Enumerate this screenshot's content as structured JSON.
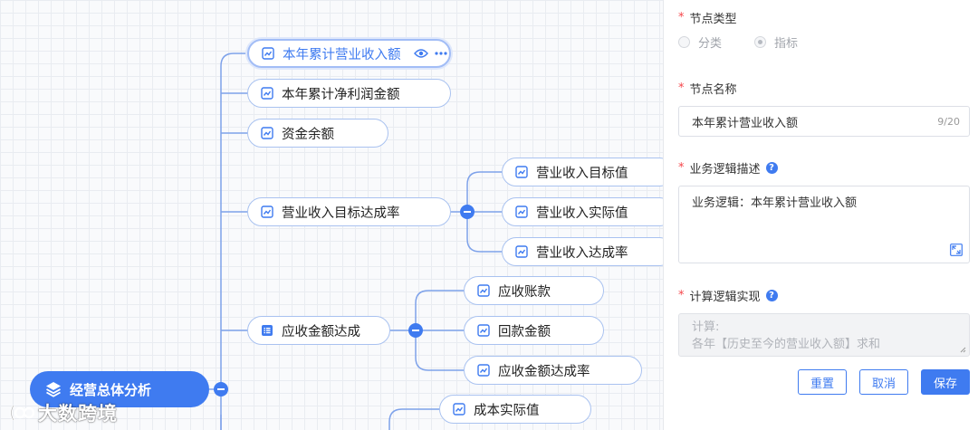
{
  "mindmap": {
    "root": {
      "label": "经营总体分析"
    },
    "nodes": [
      {
        "label": "本年累计营业收入额",
        "icon": "trend-chart-icon"
      },
      {
        "label": "本年累计净利润金额",
        "icon": "trend-chart-icon"
      },
      {
        "label": "资金余额",
        "icon": "trend-chart-icon"
      },
      {
        "label": "营业收入目标达成率",
        "icon": "trend-chart-icon"
      },
      {
        "label": "营业收入目标值",
        "icon": "trend-chart-icon"
      },
      {
        "label": "营业收入实际值",
        "icon": "trend-chart-icon"
      },
      {
        "label": "营业收入达成率",
        "icon": "trend-chart-icon"
      },
      {
        "label": "应收金额达成",
        "icon": "list-icon"
      },
      {
        "label": "应收账款",
        "icon": "trend-chart-icon"
      },
      {
        "label": "回款金额",
        "icon": "trend-chart-icon"
      },
      {
        "label": "应收金额达成率",
        "icon": "trend-chart-icon"
      },
      {
        "label": "成本实际值",
        "icon": "trend-chart-icon"
      }
    ],
    "watermark": "大数跨境",
    "colors": {
      "accent": "#3f7bf0",
      "node_border": "#a9c2f0",
      "line": "#7ea2ea"
    }
  },
  "form": {
    "node_type": {
      "label": "节点类型",
      "options": [
        {
          "label": "分类",
          "selected": false
        },
        {
          "label": "指标",
          "selected": true
        }
      ]
    },
    "node_name": {
      "label": "节点名称",
      "value": "本年累计营业收入额",
      "count": "9/20"
    },
    "business_logic": {
      "label": "业务逻辑描述",
      "value": "业务逻辑：本年累计营业收入额"
    },
    "calc_logic": {
      "label": "计算逻辑实现",
      "line1": "计算:",
      "line2": "各年【历史至今的营业收入额】求和"
    },
    "buttons": {
      "reset": "重置",
      "cancel": "取消",
      "save": "保存"
    },
    "required_mark": "*",
    "help_mark": "?"
  }
}
